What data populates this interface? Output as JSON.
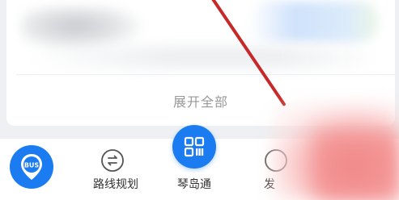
{
  "content_card": {
    "expand_all_label": "展开全部"
  },
  "bottom_nav": {
    "items": [
      {
        "id": "bus",
        "label": "",
        "icon_text": "BUS",
        "icon": "bus-pin-icon"
      },
      {
        "id": "route",
        "label": "路线规划",
        "icon": "route-planning-icon"
      },
      {
        "id": "qindaotong",
        "label": "琴岛通",
        "icon": "qr-code-icon"
      },
      {
        "id": "partial",
        "label": "发",
        "icon": "circle-icon"
      }
    ]
  },
  "colors": {
    "accent": "#1b7cf2",
    "annotation_red": "#c72828",
    "muted_text": "#999999"
  }
}
